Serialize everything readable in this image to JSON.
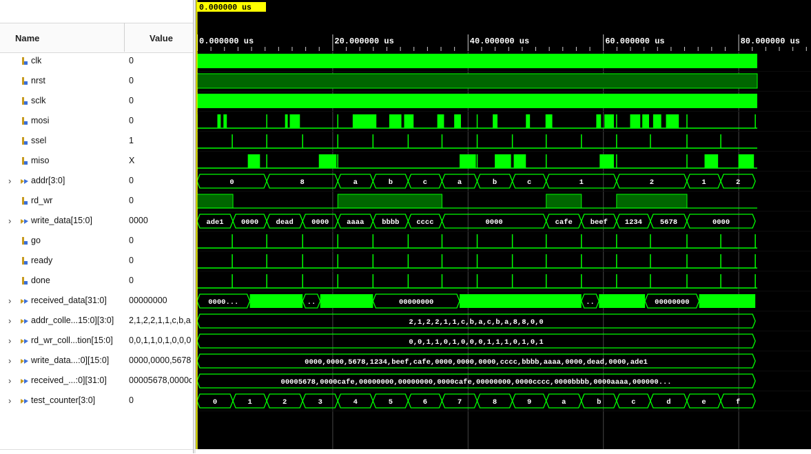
{
  "columns": {
    "name": "Name",
    "value": "Value"
  },
  "cursor_label": "0.000000 us",
  "ruler": [
    {
      "label": "0.000000 us",
      "t": 0
    },
    {
      "label": "20.000000 us",
      "t": 20
    },
    {
      "label": "40.000000 us",
      "t": 40
    },
    {
      "label": "60.000000 us",
      "t": 60
    },
    {
      "label": "80.000000 us",
      "t": 80
    }
  ],
  "signals": [
    {
      "name": "clk",
      "value": "0",
      "kind": "bit",
      "expandable": false
    },
    {
      "name": "nrst",
      "value": "0",
      "kind": "bit",
      "expandable": false
    },
    {
      "name": "sclk",
      "value": "0",
      "kind": "bit",
      "expandable": false
    },
    {
      "name": "mosi",
      "value": "0",
      "kind": "bit",
      "expandable": false
    },
    {
      "name": "ssel",
      "value": "1",
      "kind": "bit",
      "expandable": false
    },
    {
      "name": "miso",
      "value": "X",
      "kind": "bit",
      "expandable": false
    },
    {
      "name": "addr[3:0]",
      "value": "0",
      "kind": "bus",
      "expandable": true
    },
    {
      "name": "rd_wr",
      "value": "0",
      "kind": "bit",
      "expandable": false
    },
    {
      "name": "write_data[15:0]",
      "value": "0000",
      "kind": "bus",
      "expandable": true
    },
    {
      "name": "go",
      "value": "0",
      "kind": "bit",
      "expandable": false
    },
    {
      "name": "ready",
      "value": "0",
      "kind": "bit",
      "expandable": false
    },
    {
      "name": "done",
      "value": "0",
      "kind": "bit",
      "expandable": false
    },
    {
      "name": "received_data[31:0]",
      "value": "00000000",
      "kind": "bus",
      "expandable": true
    },
    {
      "name": "addr_colle...15:0][3:0]",
      "value": "2,1,2,2,1,1,c,b,a,c,b,a,8,8,0,0",
      "kind": "bus",
      "expandable": true
    },
    {
      "name": "rd_wr_coll...tion[15:0]",
      "value": "0,0,1,1,0,1,0,0,0,1,1,1,0,1,0,1",
      "kind": "bus",
      "expandable": true
    },
    {
      "name": "write_data...:0][15:0]",
      "value": "0000,0000,5678,1234,beef,cafe,0000,0000,0000,cccc,bbbb,aaaa,0000,dead,0000,ade1",
      "kind": "bus",
      "expandable": true
    },
    {
      "name": "received_...:0][31:0]",
      "value": "00005678,0000cafe,00000000,00000000,0000cafe,00000000,0000cccc,0000bbbb,0000aaaa,000000...",
      "kind": "bus",
      "expandable": true
    },
    {
      "name": "test_counter[3:0]",
      "value": "0",
      "kind": "bus",
      "expandable": true
    }
  ],
  "bus_segments": {
    "addr": [
      {
        "from": 0,
        "to": 10.3,
        "label": "0"
      },
      {
        "from": 10.3,
        "to": 20.8,
        "label": "8"
      },
      {
        "from": 20.8,
        "to": 26.0,
        "label": "a"
      },
      {
        "from": 26.0,
        "to": 31.2,
        "label": "b"
      },
      {
        "from": 31.2,
        "to": 36.2,
        "label": "c"
      },
      {
        "from": 36.2,
        "to": 41.4,
        "label": "a"
      },
      {
        "from": 41.4,
        "to": 46.6,
        "label": "b"
      },
      {
        "from": 46.6,
        "to": 51.6,
        "label": "c"
      },
      {
        "from": 51.6,
        "to": 62.0,
        "label": "1"
      },
      {
        "from": 62.0,
        "to": 72.4,
        "label": "2"
      },
      {
        "from": 72.4,
        "to": 77.4,
        "label": "1"
      },
      {
        "from": 77.4,
        "to": 82.5,
        "label": "2"
      }
    ],
    "write_data": [
      {
        "from": 0,
        "to": 5.3,
        "label": "ade1"
      },
      {
        "from": 5.3,
        "to": 10.3,
        "label": "0000"
      },
      {
        "from": 10.3,
        "to": 15.6,
        "label": "dead"
      },
      {
        "from": 15.6,
        "to": 20.8,
        "label": "0000"
      },
      {
        "from": 20.8,
        "to": 26.0,
        "label": "aaaa"
      },
      {
        "from": 26.0,
        "to": 31.2,
        "label": "bbbb"
      },
      {
        "from": 31.2,
        "to": 36.2,
        "label": "cccc"
      },
      {
        "from": 36.2,
        "to": 51.6,
        "label": "0000"
      },
      {
        "from": 51.6,
        "to": 56.8,
        "label": "cafe"
      },
      {
        "from": 56.8,
        "to": 62.0,
        "label": "beef"
      },
      {
        "from": 62.0,
        "to": 67.0,
        "label": "1234"
      },
      {
        "from": 67.0,
        "to": 72.4,
        "label": "5678"
      },
      {
        "from": 72.4,
        "to": 82.5,
        "label": "0000"
      }
    ],
    "received_data": [
      {
        "from": 0,
        "to": 7.8,
        "label": "0000..."
      },
      {
        "from": 7.8,
        "to": 15.6,
        "label": "",
        "solid": true
      },
      {
        "from": 15.6,
        "to": 18.2,
        "label": ".."
      },
      {
        "from": 18.2,
        "to": 26.0,
        "label": "",
        "solid": true
      },
      {
        "from": 26.0,
        "to": 38.8,
        "label": "00000000"
      },
      {
        "from": 38.8,
        "to": 56.8,
        "label": "",
        "solid": true
      },
      {
        "from": 56.8,
        "to": 59.4,
        "label": ".."
      },
      {
        "from": 59.4,
        "to": 66.2,
        "label": "",
        "solid": true
      },
      {
        "from": 66.2,
        "to": 74.2,
        "label": "00000000"
      },
      {
        "from": 74.2,
        "to": 82.5,
        "label": "",
        "solid": true
      }
    ],
    "addr_collection": [
      {
        "from": 0,
        "to": 82.5,
        "label": "2,1,2,2,1,1,c,b,a,c,b,a,8,8,0,0"
      }
    ],
    "rd_wr_collection": [
      {
        "from": 0,
        "to": 82.5,
        "label": "0,0,1,1,0,1,0,0,0,1,1,1,0,1,0,1"
      }
    ],
    "write_data_collection": [
      {
        "from": 0,
        "to": 82.5,
        "label": "0000,0000,5678,1234,beef,cafe,0000,0000,0000,cccc,bbbb,aaaa,0000,dead,0000,ade1"
      }
    ],
    "received_collection": [
      {
        "from": 0,
        "to": 82.5,
        "label": "00005678,0000cafe,00000000,00000000,0000cafe,00000000,0000cccc,0000bbbb,0000aaaa,000000..."
      }
    ],
    "test_counter": [
      {
        "from": 0,
        "to": 5.3,
        "label": "0"
      },
      {
        "from": 5.3,
        "to": 10.3,
        "label": "1"
      },
      {
        "from": 10.3,
        "to": 15.6,
        "label": "2"
      },
      {
        "from": 15.6,
        "to": 20.8,
        "label": "3"
      },
      {
        "from": 20.8,
        "to": 26.0,
        "label": "4"
      },
      {
        "from": 26.0,
        "to": 31.2,
        "label": "5"
      },
      {
        "from": 31.2,
        "to": 36.2,
        "label": "6"
      },
      {
        "from": 36.2,
        "to": 41.4,
        "label": "7"
      },
      {
        "from": 41.4,
        "to": 46.6,
        "label": "8"
      },
      {
        "from": 46.6,
        "to": 51.6,
        "label": "9"
      },
      {
        "from": 51.6,
        "to": 56.8,
        "label": "a"
      },
      {
        "from": 56.8,
        "to": 62.0,
        "label": "b"
      },
      {
        "from": 62.0,
        "to": 67.0,
        "label": "c"
      },
      {
        "from": 67.0,
        "to": 72.4,
        "label": "d"
      },
      {
        "from": 72.4,
        "to": 77.4,
        "label": "e"
      },
      {
        "from": 77.4,
        "to": 82.5,
        "label": "f"
      }
    ]
  },
  "colors": {
    "wave": "#00ff00",
    "background": "#000000",
    "cursor": "#ffff00",
    "grid": "#3a3a3a"
  }
}
